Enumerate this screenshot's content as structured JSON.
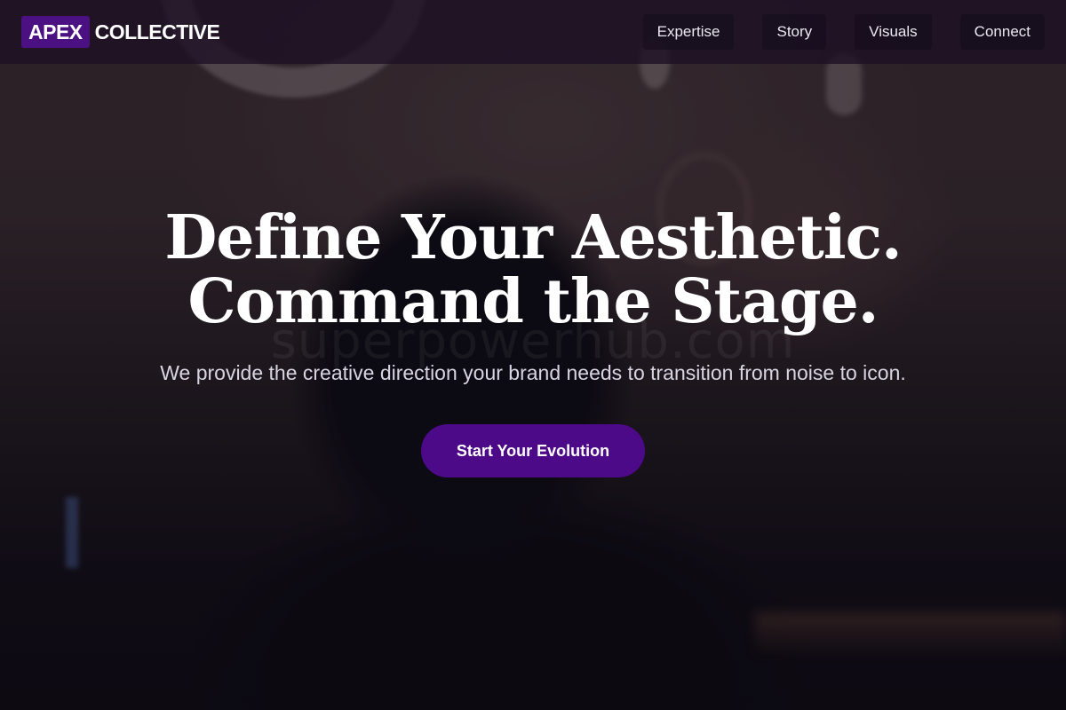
{
  "brand": {
    "mark": "APEX",
    "word": "COLLECTIVE"
  },
  "nav": {
    "items": [
      {
        "label": "Expertise"
      },
      {
        "label": "Story"
      },
      {
        "label": "Visuals"
      },
      {
        "label": "Connect"
      }
    ]
  },
  "hero": {
    "title_line1": "Define Your Aesthetic.",
    "title_line2": "Command the Stage.",
    "subtitle": "We provide the creative direction your brand needs to transition from noise to icon.",
    "cta_label": "Start Your Evolution"
  },
  "watermark": "superpowerhub.com",
  "colors": {
    "accent": "#4b1182",
    "cta": "#4d0a88",
    "header_bg": "#1c1024"
  }
}
